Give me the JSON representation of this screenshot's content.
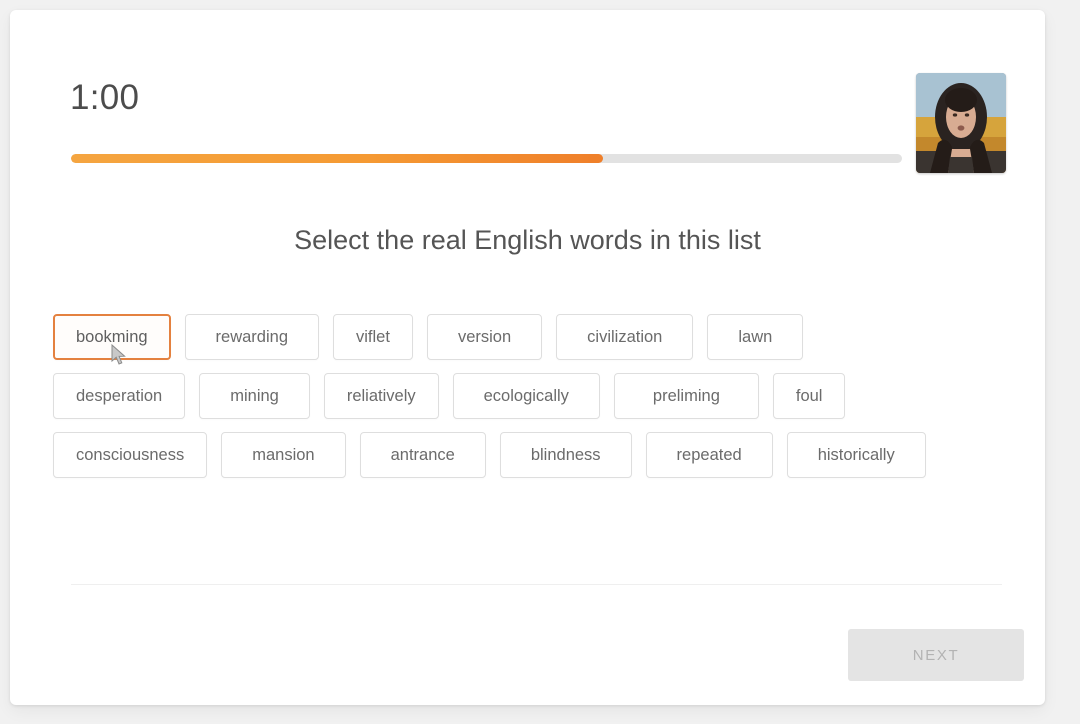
{
  "header": {
    "timer": "1:00",
    "webcam_label": "webcam-video-preview"
  },
  "progress": {
    "percent": 64,
    "fill_color": "#f2902f",
    "track_color": "#e2e2e2"
  },
  "main": {
    "prompt": "Select the real English words in this list"
  },
  "word_rows": [
    [
      {
        "label": "bookming",
        "selected": true,
        "size": "normal"
      },
      {
        "label": "rewarding",
        "selected": false,
        "size": "wide"
      },
      {
        "label": "viflet",
        "selected": false,
        "size": "normal"
      },
      {
        "label": "version",
        "selected": false,
        "size": "wide"
      },
      {
        "label": "civilization",
        "selected": false,
        "size": "wide"
      },
      {
        "label": "lawn",
        "selected": false,
        "size": "wide"
      }
    ],
    [
      {
        "label": "desperation",
        "selected": false,
        "size": "normal"
      },
      {
        "label": "mining",
        "selected": false,
        "size": "wide"
      },
      {
        "label": "reliatively",
        "selected": false,
        "size": "normal"
      },
      {
        "label": "ecologically",
        "selected": false,
        "size": "wide"
      },
      {
        "label": "preliming",
        "selected": false,
        "size": "wider"
      },
      {
        "label": "foul",
        "selected": false,
        "size": "normal"
      }
    ],
    [
      {
        "label": "consciousness",
        "selected": false,
        "size": "normal"
      },
      {
        "label": "mansion",
        "selected": false,
        "size": "wide"
      },
      {
        "label": "antrance",
        "selected": false,
        "size": "wide"
      },
      {
        "label": "blindness",
        "selected": false,
        "size": "wide"
      },
      {
        "label": "repeated",
        "selected": false,
        "size": "wide"
      },
      {
        "label": "historically",
        "selected": false,
        "size": "wide"
      }
    ]
  ],
  "footer": {
    "next_label": "NEXT",
    "next_disabled": true
  },
  "colors": {
    "accent": "#e4813f",
    "progress": "#f2902f",
    "page_background": "#f1f1f1",
    "card_background": "#ffffff",
    "text_primary": "#555555",
    "text_muted": "#6b6b6b"
  }
}
